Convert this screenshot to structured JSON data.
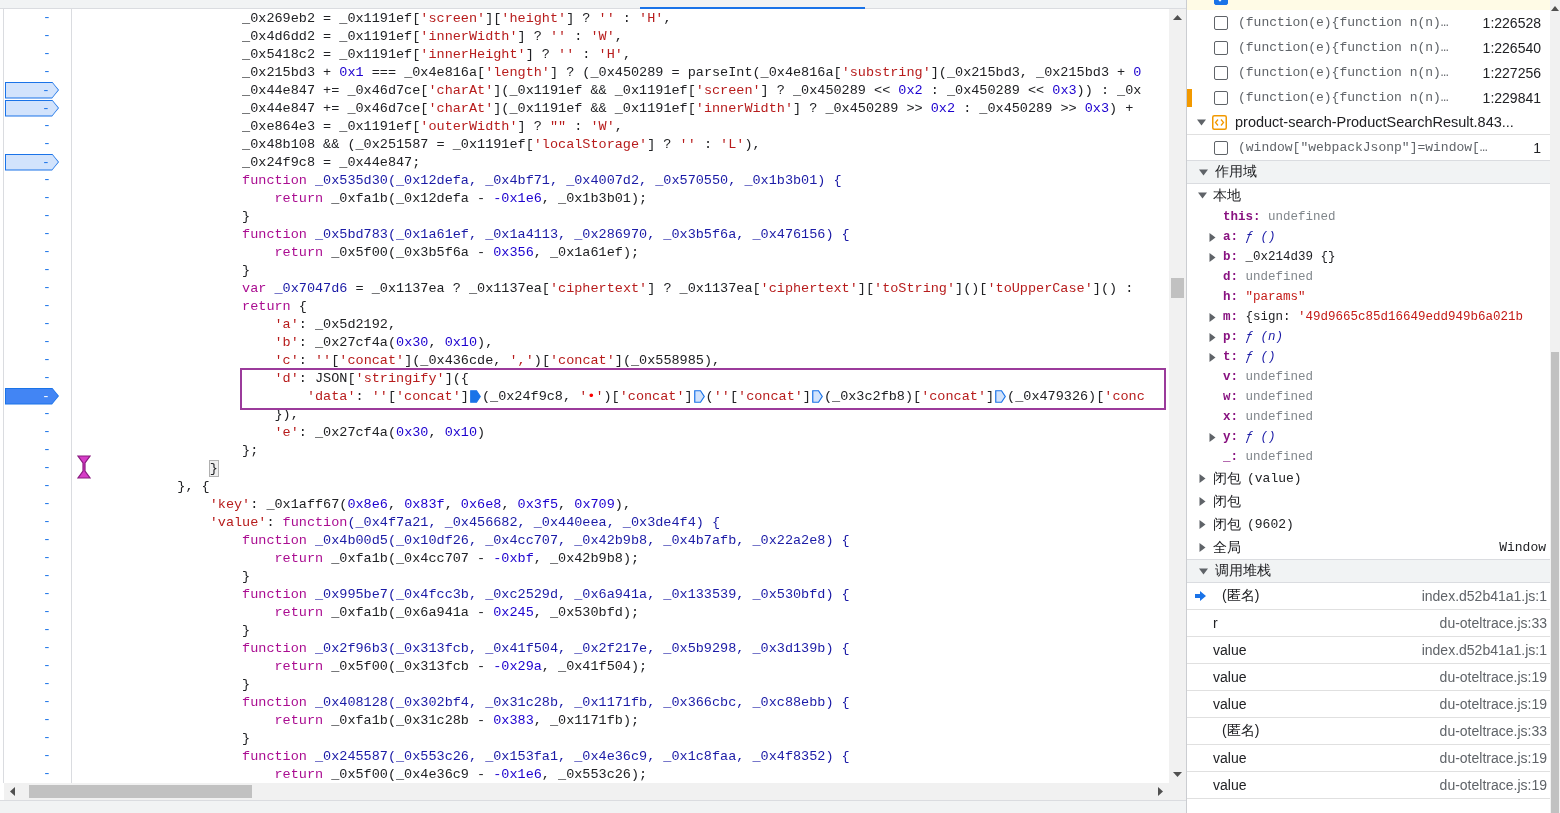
{
  "editor": {
    "lines": [
      {
        "number": "-",
        "breakpoint": false,
        "current": false,
        "boxed": false,
        "code": [
          {
            "kind": "plain",
            "text": "                     _0x269eb2 = _0x1191ef["
          },
          {
            "kind": "string",
            "text": "'screen'"
          },
          {
            "kind": "plain",
            "text": "]["
          },
          {
            "kind": "string",
            "text": "'height'"
          },
          {
            "kind": "plain",
            "text": "] ? "
          },
          {
            "kind": "string",
            "text": "''"
          },
          {
            "kind": "plain",
            "text": " : "
          },
          {
            "kind": "string",
            "text": "'H'"
          },
          {
            "kind": "plain",
            "text": ","
          }
        ]
      },
      {
        "number": "-",
        "breakpoint": false,
        "current": false,
        "boxed": false,
        "code": [
          {
            "kind": "plain",
            "text": "                     _0x4d6dd2 = _0x1191ef["
          },
          {
            "kind": "string",
            "text": "'innerWidth'"
          },
          {
            "kind": "plain",
            "text": "] ? "
          },
          {
            "kind": "string",
            "text": "''"
          },
          {
            "kind": "plain",
            "text": " : "
          },
          {
            "kind": "string",
            "text": "'W'"
          },
          {
            "kind": "plain",
            "text": ","
          }
        ]
      },
      {
        "number": "-",
        "breakpoint": false,
        "current": false,
        "boxed": false,
        "code": [
          {
            "kind": "plain",
            "text": "                     _0x5418c2 = _0x1191ef["
          },
          {
            "kind": "string",
            "text": "'innerHeight'"
          },
          {
            "kind": "plain",
            "text": "] ? "
          },
          {
            "kind": "string",
            "text": "''"
          },
          {
            "kind": "plain",
            "text": " : "
          },
          {
            "kind": "string",
            "text": "'H'"
          },
          {
            "kind": "plain",
            "text": ","
          }
        ]
      },
      {
        "number": "-",
        "breakpoint": false,
        "current": false,
        "boxed": false,
        "code": [
          {
            "kind": "plain",
            "text": "                     _0x215bd3 + "
          },
          {
            "kind": "number",
            "text": "0x1"
          },
          {
            "kind": "plain",
            "text": " === _0x4e816a["
          },
          {
            "kind": "string",
            "text": "'length'"
          },
          {
            "kind": "plain",
            "text": "] ? (_0x450289 = parseInt(_0x4e816a["
          },
          {
            "kind": "string",
            "text": "'substring'"
          },
          {
            "kind": "plain",
            "text": "](_0x215bd3, _0x215bd3 + "
          },
          {
            "kind": "number",
            "text": "0"
          }
        ]
      },
      {
        "number": "-",
        "breakpoint": true,
        "current": false,
        "boxed": false,
        "code": [
          {
            "kind": "plain",
            "text": "                     _0x44e847 += _0x46d7ce["
          },
          {
            "kind": "string",
            "text": "'charAt'"
          },
          {
            "kind": "plain",
            "text": "](_0x1191ef && _0x1191ef["
          },
          {
            "kind": "string",
            "text": "'screen'"
          },
          {
            "kind": "plain",
            "text": "] ? _0x450289 << "
          },
          {
            "kind": "number",
            "text": "0x2"
          },
          {
            "kind": "plain",
            "text": " : _0x450289 << "
          },
          {
            "kind": "number",
            "text": "0x3"
          },
          {
            "kind": "plain",
            "text": ")) : _0x"
          }
        ]
      },
      {
        "number": "-",
        "breakpoint": true,
        "current": false,
        "boxed": false,
        "code": [
          {
            "kind": "plain",
            "text": "                     _0x44e847 += _0x46d7ce["
          },
          {
            "kind": "string",
            "text": "'charAt'"
          },
          {
            "kind": "plain",
            "text": "](_0x1191ef && _0x1191ef["
          },
          {
            "kind": "string",
            "text": "'innerWidth'"
          },
          {
            "kind": "plain",
            "text": "] ? _0x450289 >> "
          },
          {
            "kind": "number",
            "text": "0x2"
          },
          {
            "kind": "plain",
            "text": " : _0x450289 >> "
          },
          {
            "kind": "number",
            "text": "0x3"
          },
          {
            "kind": "plain",
            "text": ") +"
          }
        ]
      },
      {
        "number": "-",
        "breakpoint": false,
        "current": false,
        "boxed": false,
        "code": [
          {
            "kind": "plain",
            "text": "                     _0xe864e3 = _0x1191ef["
          },
          {
            "kind": "string",
            "text": "'outerWidth'"
          },
          {
            "kind": "plain",
            "text": "] ? "
          },
          {
            "kind": "string",
            "text": "\"\""
          },
          {
            "kind": "plain",
            "text": " : "
          },
          {
            "kind": "string",
            "text": "'W'"
          },
          {
            "kind": "plain",
            "text": ","
          }
        ]
      },
      {
        "number": "-",
        "breakpoint": false,
        "current": false,
        "boxed": false,
        "code": [
          {
            "kind": "plain",
            "text": "                     _0x48b108 && (_0x251587 = _0x1191ef["
          },
          {
            "kind": "string",
            "text": "'localStorage'"
          },
          {
            "kind": "plain",
            "text": "] ? "
          },
          {
            "kind": "string",
            "text": "''"
          },
          {
            "kind": "plain",
            "text": " : "
          },
          {
            "kind": "string",
            "text": "'L'"
          },
          {
            "kind": "plain",
            "text": "),"
          }
        ]
      },
      {
        "number": "-",
        "breakpoint": true,
        "current": false,
        "boxed": false,
        "code": [
          {
            "kind": "plain",
            "text": "                     _0x24f9c8 = _0x44e847;"
          }
        ]
      },
      {
        "number": "-",
        "breakpoint": false,
        "current": false,
        "boxed": false,
        "code": [
          {
            "kind": "keyword",
            "text": "                     function"
          },
          {
            "kind": "name",
            "text": " _0x535d30(_0x12defa, _0x4bf71, _0x4007d2, _0x570550, _0x1b3b01) {"
          }
        ]
      },
      {
        "number": "-",
        "breakpoint": false,
        "current": false,
        "boxed": false,
        "code": [
          {
            "kind": "keyword",
            "text": "                         return"
          },
          {
            "kind": "plain",
            "text": " _0xfa1b(_0x12defa - "
          },
          {
            "kind": "number",
            "text": "-0x1e6"
          },
          {
            "kind": "plain",
            "text": ", _0x1b3b01);"
          }
        ]
      },
      {
        "number": "-",
        "breakpoint": false,
        "current": false,
        "boxed": false,
        "code": [
          {
            "kind": "plain",
            "text": "                     }"
          }
        ]
      },
      {
        "number": "-",
        "breakpoint": false,
        "current": false,
        "boxed": false,
        "code": [
          {
            "kind": "keyword",
            "text": "                     function"
          },
          {
            "kind": "name",
            "text": " _0x5bd783(_0x1a61ef, _0x1a4113, _0x286970, _0x3b5f6a, _0x476156) {"
          }
        ]
      },
      {
        "number": "-",
        "breakpoint": false,
        "current": false,
        "boxed": false,
        "code": [
          {
            "kind": "keyword",
            "text": "                         return"
          },
          {
            "kind": "plain",
            "text": " _0x5f00(_0x3b5f6a - "
          },
          {
            "kind": "number",
            "text": "0x356"
          },
          {
            "kind": "plain",
            "text": ", _0x1a61ef);"
          }
        ]
      },
      {
        "number": "-",
        "breakpoint": false,
        "current": false,
        "boxed": false,
        "code": [
          {
            "kind": "plain",
            "text": "                     }"
          }
        ]
      },
      {
        "number": "-",
        "breakpoint": false,
        "current": false,
        "boxed": false,
        "code": [
          {
            "kind": "keyword",
            "text": "                     var"
          },
          {
            "kind": "name",
            "text": " _0x7047d6"
          },
          {
            "kind": "plain",
            "text": " = _0x1137ea ? _0x1137ea["
          },
          {
            "kind": "string",
            "text": "'ciphertext'"
          },
          {
            "kind": "plain",
            "text": "] ? _0x1137ea["
          },
          {
            "kind": "string",
            "text": "'ciphertext'"
          },
          {
            "kind": "plain",
            "text": "]["
          },
          {
            "kind": "string",
            "text": "'toString'"
          },
          {
            "kind": "plain",
            "text": "]()["
          },
          {
            "kind": "string",
            "text": "'toUpperCase'"
          },
          {
            "kind": "plain",
            "text": "]() :"
          }
        ]
      },
      {
        "number": "-",
        "breakpoint": false,
        "current": false,
        "boxed": false,
        "code": [
          {
            "kind": "keyword",
            "text": "                     return"
          },
          {
            "kind": "plain",
            "text": " {"
          }
        ]
      },
      {
        "number": "-",
        "breakpoint": false,
        "current": false,
        "boxed": false,
        "code": [
          {
            "kind": "string",
            "text": "                         'a'"
          },
          {
            "kind": "plain",
            "text": ": _0x5d2192,"
          }
        ]
      },
      {
        "number": "-",
        "breakpoint": false,
        "current": false,
        "boxed": false,
        "code": [
          {
            "kind": "string",
            "text": "                         'b'"
          },
          {
            "kind": "plain",
            "text": ": _0x27cf4a("
          },
          {
            "kind": "number",
            "text": "0x30"
          },
          {
            "kind": "plain",
            "text": ", "
          },
          {
            "kind": "number",
            "text": "0x10"
          },
          {
            "kind": "plain",
            "text": "),"
          }
        ]
      },
      {
        "number": "-",
        "breakpoint": false,
        "current": false,
        "boxed": false,
        "code": [
          {
            "kind": "string",
            "text": "                         'c'"
          },
          {
            "kind": "plain",
            "text": ": "
          },
          {
            "kind": "string",
            "text": "''"
          },
          {
            "kind": "plain",
            "text": "["
          },
          {
            "kind": "string",
            "text": "'concat'"
          },
          {
            "kind": "plain",
            "text": "](_0x436cde, "
          },
          {
            "kind": "string",
            "text": "','"
          },
          {
            "kind": "plain",
            "text": ")["
          },
          {
            "kind": "string",
            "text": "'concat'"
          },
          {
            "kind": "plain",
            "text": "](_0x558985),"
          }
        ]
      },
      {
        "number": "-",
        "breakpoint": false,
        "current": false,
        "boxed": true,
        "code": [
          {
            "kind": "string",
            "text": "                         'd'"
          },
          {
            "kind": "plain",
            "text": ": JSON["
          },
          {
            "kind": "string",
            "text": "'stringify'"
          },
          {
            "kind": "plain",
            "text": "]({"
          }
        ]
      },
      {
        "number": "-",
        "breakpoint": true,
        "current": true,
        "boxed": true,
        "code": [
          {
            "kind": "string",
            "text": "                             'data'"
          },
          {
            "kind": "plain",
            "text": ": "
          },
          {
            "kind": "string",
            "text": "''"
          },
          {
            "kind": "plain",
            "text": "["
          },
          {
            "kind": "string",
            "text": "'concat'"
          },
          {
            "kind": "plain",
            "text": "]"
          },
          {
            "kind": "breakpoint-on"
          },
          {
            "kind": "plain",
            "text": "(_0x24f9c8, "
          },
          {
            "kind": "string",
            "text": "'"
          },
          {
            "kind": "mark",
            "text": "•"
          },
          {
            "kind": "string",
            "text": "'"
          },
          {
            "kind": "plain",
            "text": ")["
          },
          {
            "kind": "string",
            "text": "'concat'"
          },
          {
            "kind": "plain",
            "text": "]"
          },
          {
            "kind": "breakpoint-off"
          },
          {
            "kind": "plain",
            "text": "("
          },
          {
            "kind": "string",
            "text": "''"
          },
          {
            "kind": "plain",
            "text": "["
          },
          {
            "kind": "string",
            "text": "'concat'"
          },
          {
            "kind": "plain",
            "text": "]"
          },
          {
            "kind": "breakpoint-off"
          },
          {
            "kind": "plain",
            "text": "(_0x3c2fb8)["
          },
          {
            "kind": "string",
            "text": "'concat'"
          },
          {
            "kind": "plain",
            "text": "]"
          },
          {
            "kind": "breakpoint-off"
          },
          {
            "kind": "plain",
            "text": "(_0x479326)["
          },
          {
            "kind": "string",
            "text": "'conc"
          }
        ]
      },
      {
        "number": "-",
        "breakpoint": false,
        "current": false,
        "boxed": false,
        "code": [
          {
            "kind": "plain",
            "text": "                         }),"
          }
        ]
      },
      {
        "number": "-",
        "breakpoint": false,
        "current": false,
        "boxed": false,
        "code": [
          {
            "kind": "string",
            "text": "                         'e'"
          },
          {
            "kind": "plain",
            "text": ": _0x27cf4a("
          },
          {
            "kind": "number",
            "text": "0x30"
          },
          {
            "kind": "plain",
            "text": ", "
          },
          {
            "kind": "number",
            "text": "0x10"
          },
          {
            "kind": "plain",
            "text": ")"
          }
        ]
      },
      {
        "number": "-",
        "breakpoint": false,
        "current": false,
        "boxed": false,
        "code": [
          {
            "kind": "plain",
            "text": "                     };"
          }
        ]
      },
      {
        "number": "-",
        "breakpoint": false,
        "current": false,
        "boxed": false,
        "code": [
          {
            "kind": "match",
            "text": "                 }"
          }
        ]
      },
      {
        "number": "-",
        "breakpoint": false,
        "current": false,
        "boxed": false,
        "code": [
          {
            "kind": "plain",
            "text": "             }, {"
          }
        ]
      },
      {
        "number": "-",
        "breakpoint": false,
        "current": false,
        "boxed": false,
        "code": [
          {
            "kind": "string",
            "text": "                 'key'"
          },
          {
            "kind": "plain",
            "text": ": _0x1aff67("
          },
          {
            "kind": "number",
            "text": "0x8e6"
          },
          {
            "kind": "plain",
            "text": ", "
          },
          {
            "kind": "number",
            "text": "0x83f"
          },
          {
            "kind": "plain",
            "text": ", "
          },
          {
            "kind": "number",
            "text": "0x6e8"
          },
          {
            "kind": "plain",
            "text": ", "
          },
          {
            "kind": "number",
            "text": "0x3f5"
          },
          {
            "kind": "plain",
            "text": ", "
          },
          {
            "kind": "number",
            "text": "0x709"
          },
          {
            "kind": "plain",
            "text": "),"
          }
        ]
      },
      {
        "number": "-",
        "breakpoint": false,
        "current": false,
        "boxed": false,
        "code": [
          {
            "kind": "string",
            "text": "                 'value'"
          },
          {
            "kind": "plain",
            "text": ": "
          },
          {
            "kind": "keyword",
            "text": "function"
          },
          {
            "kind": "name",
            "text": "(_0x4f7a21, _0x456682, _0x440eea, _0x3de4f4) {"
          }
        ]
      },
      {
        "number": "-",
        "breakpoint": false,
        "current": false,
        "boxed": false,
        "code": [
          {
            "kind": "keyword",
            "text": "                     function"
          },
          {
            "kind": "name",
            "text": " _0x4b00d5(_0x10df26, _0x4cc707, _0x42b9b8, _0x4b7afb, _0x22a2e8) {"
          }
        ]
      },
      {
        "number": "-",
        "breakpoint": false,
        "current": false,
        "boxed": false,
        "code": [
          {
            "kind": "keyword",
            "text": "                         return"
          },
          {
            "kind": "plain",
            "text": " _0xfa1b(_0x4cc707 - "
          },
          {
            "kind": "number",
            "text": "-0xbf"
          },
          {
            "kind": "plain",
            "text": ", _0x42b9b8);"
          }
        ]
      },
      {
        "number": "-",
        "breakpoint": false,
        "current": false,
        "boxed": false,
        "code": [
          {
            "kind": "plain",
            "text": "                     }"
          }
        ]
      },
      {
        "number": "-",
        "breakpoint": false,
        "current": false,
        "boxed": false,
        "code": [
          {
            "kind": "keyword",
            "text": "                     function"
          },
          {
            "kind": "name",
            "text": " _0x995be7(_0x4fcc3b, _0xc2529d, _0x6a941a, _0x133539, _0x530bfd) {"
          }
        ]
      },
      {
        "number": "-",
        "breakpoint": false,
        "current": false,
        "boxed": false,
        "code": [
          {
            "kind": "keyword",
            "text": "                         return"
          },
          {
            "kind": "plain",
            "text": " _0xfa1b(_0x6a941a - "
          },
          {
            "kind": "number",
            "text": "0x245"
          },
          {
            "kind": "plain",
            "text": ", _0x530bfd);"
          }
        ]
      },
      {
        "number": "-",
        "breakpoint": false,
        "current": false,
        "boxed": false,
        "code": [
          {
            "kind": "plain",
            "text": "                     }"
          }
        ]
      },
      {
        "number": "-",
        "breakpoint": false,
        "current": false,
        "boxed": false,
        "code": [
          {
            "kind": "keyword",
            "text": "                     function"
          },
          {
            "kind": "name",
            "text": " _0x2f96b3(_0x313fcb, _0x41f504, _0x2f217e, _0x5b9298, _0x3d139b) {"
          }
        ]
      },
      {
        "number": "-",
        "breakpoint": false,
        "current": false,
        "boxed": false,
        "code": [
          {
            "kind": "keyword",
            "text": "                         return"
          },
          {
            "kind": "plain",
            "text": " _0x5f00(_0x313fcb - "
          },
          {
            "kind": "number",
            "text": "-0x29a"
          },
          {
            "kind": "plain",
            "text": ", _0x41f504);"
          }
        ]
      },
      {
        "number": "-",
        "breakpoint": false,
        "current": false,
        "boxed": false,
        "code": [
          {
            "kind": "plain",
            "text": "                     }"
          }
        ]
      },
      {
        "number": "-",
        "breakpoint": false,
        "current": false,
        "boxed": false,
        "code": [
          {
            "kind": "keyword",
            "text": "                     function"
          },
          {
            "kind": "name",
            "text": " _0x408128(_0x302bf4, _0x31c28b, _0x1171fb, _0x366cbc, _0xc88ebb) {"
          }
        ]
      },
      {
        "number": "-",
        "breakpoint": false,
        "current": false,
        "boxed": false,
        "code": [
          {
            "kind": "keyword",
            "text": "                         return"
          },
          {
            "kind": "plain",
            "text": " _0xfa1b(_0x31c28b - "
          },
          {
            "kind": "number",
            "text": "0x383"
          },
          {
            "kind": "plain",
            "text": ", _0x1171fb);"
          }
        ]
      },
      {
        "number": "-",
        "breakpoint": false,
        "current": false,
        "boxed": false,
        "code": [
          {
            "kind": "plain",
            "text": "                     }"
          }
        ]
      },
      {
        "number": "-",
        "breakpoint": false,
        "current": false,
        "boxed": false,
        "code": [
          {
            "kind": "keyword",
            "text": "                     function"
          },
          {
            "kind": "name",
            "text": " _0x245587(_0x553c26, _0x153fa1, _0x4e36c9, _0x1c8faa, _0x4f8352) {"
          }
        ]
      },
      {
        "number": "-",
        "breakpoint": false,
        "current": false,
        "boxed": false,
        "code": [
          {
            "kind": "keyword",
            "text": "                         return"
          },
          {
            "kind": "plain",
            "text": " _0x5f00(_0x4e36c9 - "
          },
          {
            "kind": "number",
            "text": "-0x1e6"
          },
          {
            "kind": "plain",
            "text": ", _0x553c26);"
          }
        ]
      }
    ]
  },
  "breakpoint_list": [
    {
      "kind": "breakpoint",
      "checked": true,
      "highlighted": true,
      "flagged": false
    },
    {
      "kind": "breakpoint",
      "snippet": "(function(e){function n(n)…",
      "location": "1:226528",
      "checked": false,
      "highlighted": false,
      "flagged": false
    },
    {
      "kind": "breakpoint",
      "snippet": "(function(e){function n(n)…",
      "location": "1:226540",
      "checked": false,
      "highlighted": false,
      "flagged": false
    },
    {
      "kind": "breakpoint",
      "snippet": "(function(e){function n(n)…",
      "location": "1:227256",
      "checked": false,
      "highlighted": false,
      "flagged": false
    },
    {
      "kind": "breakpoint",
      "snippet": "(function(e){function n(n)…",
      "location": "1:229841",
      "checked": false,
      "highlighted": false,
      "flagged": true
    },
    {
      "kind": "file",
      "name": "product-search-ProductSearchResult.843...",
      "expanded": true
    },
    {
      "kind": "breakpoint",
      "snippet": "(window[\"webpackJsonp\"]=window[…",
      "location": "1",
      "checked": false,
      "highlighted": false,
      "flagged": false
    }
  ],
  "scope": {
    "title": "作用域",
    "expanded": true,
    "groups": [
      {
        "label": "本地",
        "expanded": true,
        "properties": [
          {
            "name": "this:",
            "value": "undefined",
            "kind": "undefined",
            "expandable": false
          },
          {
            "name": "a:",
            "value": "ƒ ()",
            "kind": "function",
            "expandable": true
          },
          {
            "name": "b:",
            "value": "_0x214d39 {}",
            "kind": "object",
            "expandable": true
          },
          {
            "name": "d:",
            "value": "undefined",
            "kind": "undefined",
            "expandable": false
          },
          {
            "name": "h:",
            "value": "\"params\"",
            "kind": "string",
            "expandable": false
          },
          {
            "name": "m:",
            "value": "{sign: ",
            "string": "'49d9665c85d16649edd949b6a021b",
            "kind": "object",
            "expandable": true
          },
          {
            "name": "p:",
            "value": "ƒ (n)",
            "kind": "function",
            "expandable": true
          },
          {
            "name": "t:",
            "value": "ƒ ()",
            "kind": "function",
            "expandable": true
          },
          {
            "name": "v:",
            "value": "undefined",
            "kind": "undefined",
            "expandable": false
          },
          {
            "name": "w:",
            "value": "undefined",
            "kind": "undefined",
            "expandable": false
          },
          {
            "name": "x:",
            "value": "undefined",
            "kind": "undefined",
            "expandable": false
          },
          {
            "name": "y:",
            "value": "ƒ ()",
            "kind": "function",
            "expandable": true
          },
          {
            "name": "_:",
            "value": "undefined",
            "kind": "undefined",
            "expandable": false
          }
        ]
      },
      {
        "label": "闭包",
        "detail": "(value)",
        "expanded": false
      },
      {
        "label": "闭包",
        "expanded": false
      },
      {
        "label": "闭包",
        "detail": "(9602)",
        "expanded": false
      },
      {
        "label": "全局",
        "value": "Window",
        "expanded": false
      }
    ]
  },
  "call_stack": {
    "title": "调用堆栈",
    "expanded": true,
    "frames": [
      {
        "name": "(匿名)",
        "location": "index.d52b41a1.js:1",
        "selected": true,
        "kind": "anonymous"
      },
      {
        "name": "r",
        "location": "du-oteltrace.js:33",
        "selected": false,
        "kind": "named"
      },
      {
        "name": "value",
        "location": "index.d52b41a1.js:1",
        "selected": false,
        "kind": "named"
      },
      {
        "name": "value",
        "location": "du-oteltrace.js:19",
        "selected": false,
        "kind": "named"
      },
      {
        "name": "value",
        "location": "du-oteltrace.js:19",
        "selected": false,
        "kind": "named"
      },
      {
        "name": "(匿名)",
        "location": "du-oteltrace.js:33",
        "selected": false,
        "kind": "anonymous"
      },
      {
        "name": "value",
        "location": "du-oteltrace.js:19",
        "selected": false,
        "kind": "named"
      },
      {
        "name": "value",
        "location": "du-oteltrace.js:19",
        "selected": false,
        "kind": "named"
      }
    ]
  }
}
